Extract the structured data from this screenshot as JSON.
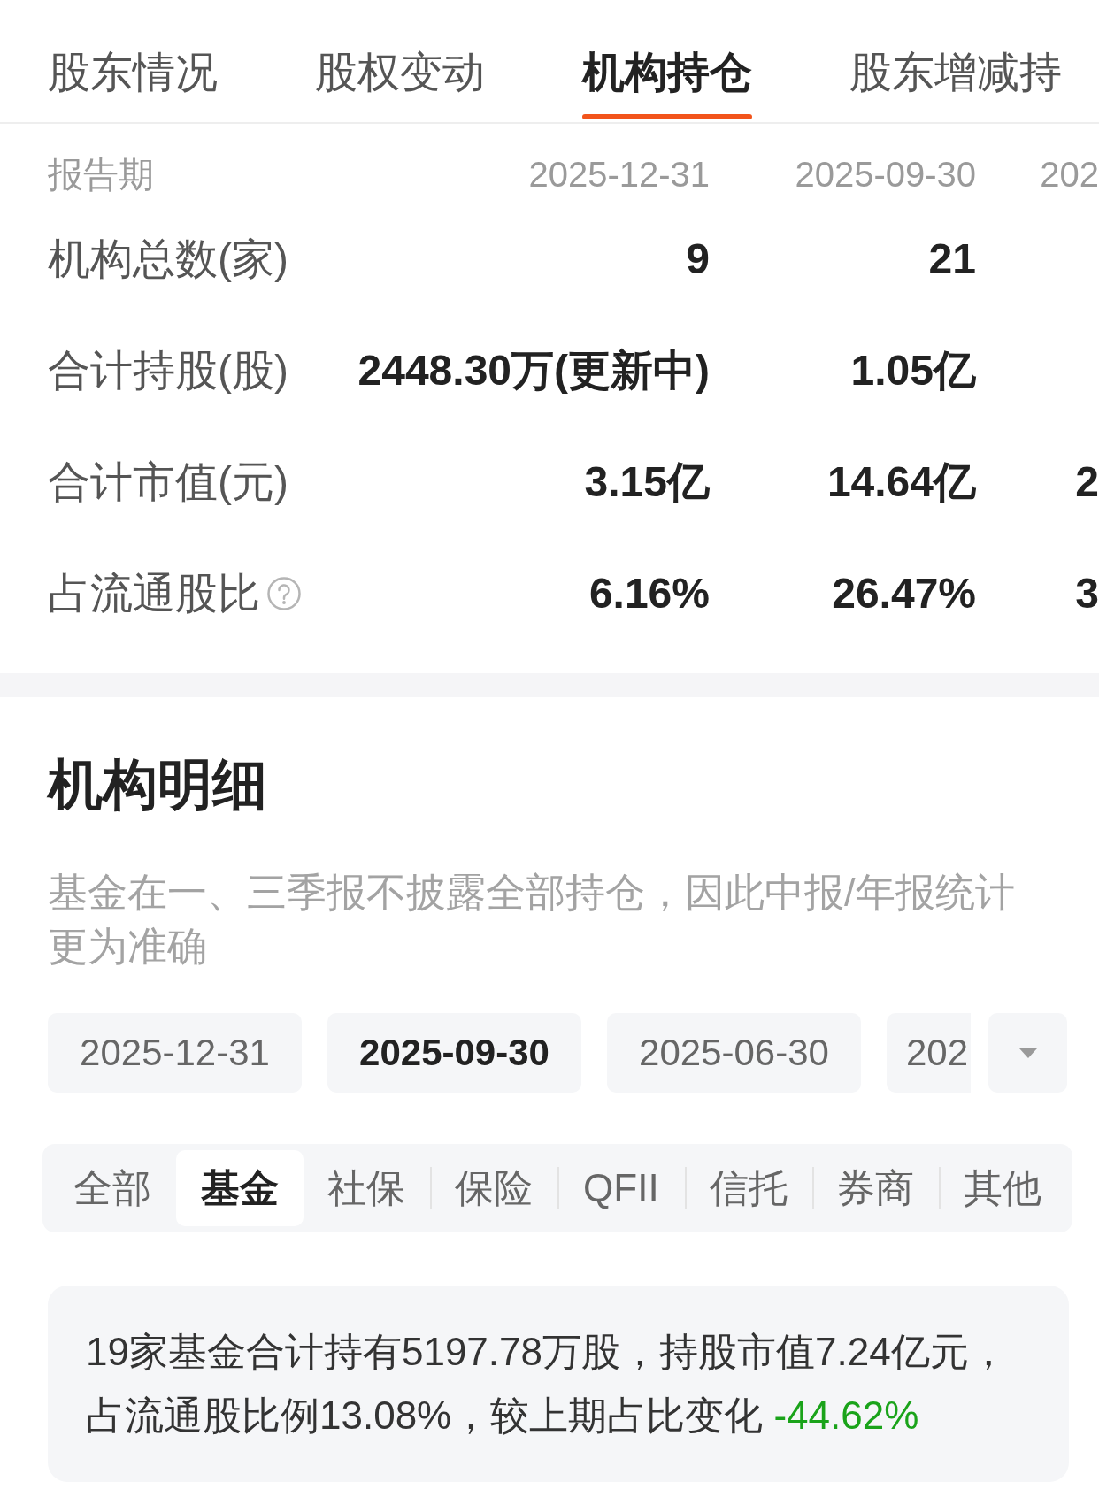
{
  "tabs": [
    {
      "label": "股东情况",
      "selected": false
    },
    {
      "label": "股权变动",
      "selected": false
    },
    {
      "label": "机构持仓",
      "selected": true
    },
    {
      "label": "股东增减持",
      "selected": false
    }
  ],
  "table": {
    "header_label": "报告期",
    "periods": [
      "2025-12-31",
      "2025-09-30",
      "202"
    ],
    "rows": [
      {
        "label": "机构总数(家)",
        "values": [
          "9",
          "21"
        ]
      },
      {
        "label": "合计持股(股)",
        "values": [
          "2448.30万(更新中)",
          "1.05亿"
        ]
      },
      {
        "label": "合计市值(元)",
        "values": [
          "3.15亿",
          "14.64亿",
          "2"
        ]
      },
      {
        "label": "占流通股比",
        "help_icon": true,
        "values": [
          "6.16%",
          "26.47%",
          "3"
        ]
      }
    ]
  },
  "detail": {
    "title": "机构明细",
    "note": "基金在一、三季报不披露全部持仓，因此中报/年报统计更为准确",
    "periods": [
      {
        "label": "2025-12-31",
        "selected": false
      },
      {
        "label": "2025-09-30",
        "selected": true
      },
      {
        "label": "2025-06-30",
        "selected": false
      },
      {
        "label": "202",
        "selected": false
      }
    ],
    "categories": [
      {
        "label": "全部",
        "selected": false
      },
      {
        "label": "基金",
        "selected": true
      },
      {
        "label": "社保",
        "selected": false
      },
      {
        "label": "保险",
        "selected": false
      },
      {
        "label": "QFII",
        "selected": false
      },
      {
        "label": "信托",
        "selected": false
      },
      {
        "label": "券商",
        "selected": false
      },
      {
        "label": "其他",
        "selected": false
      }
    ],
    "summary": {
      "text": "19家基金合计持有5197.78万股，持股市值7.24亿元，占流通股比例13.08%，较上期占比变化",
      "change": "-44.62%",
      "change_negative": true
    }
  }
}
